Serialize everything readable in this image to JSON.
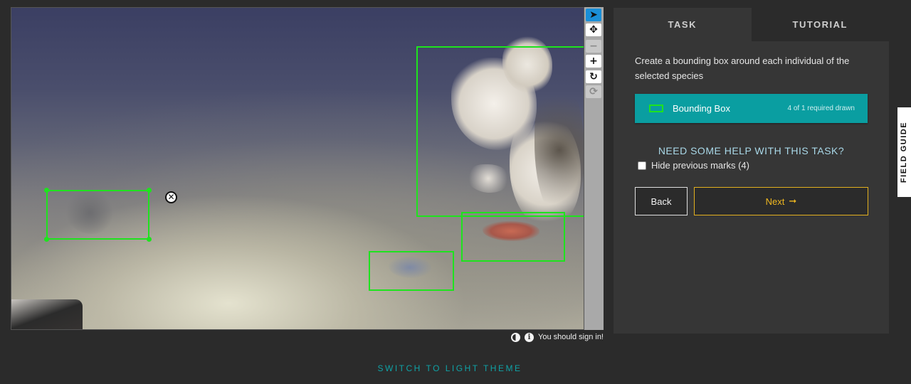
{
  "toolbar": {
    "tools": [
      {
        "name": "annotate",
        "icon": "cursor-arrow-icon",
        "glyph": "➤",
        "state": "active"
      },
      {
        "name": "move",
        "icon": "move-arrows-icon",
        "glyph": "✥",
        "state": "normal"
      },
      {
        "name": "zoom-out",
        "icon": "minus-icon",
        "glyph": "−",
        "state": "disabled"
      },
      {
        "name": "zoom-in",
        "icon": "plus-icon",
        "glyph": "+",
        "state": "normal"
      },
      {
        "name": "rotate",
        "icon": "rotate-icon",
        "glyph": "↻",
        "state": "normal"
      },
      {
        "name": "reset",
        "icon": "reset-icon",
        "glyph": "⟳",
        "state": "disabled"
      }
    ]
  },
  "subject": {
    "delete_glyph": "✕",
    "marks_count": 4
  },
  "meta": {
    "contrast_icon": "contrast-icon",
    "info_icon": "info-icon",
    "info_glyph": "i",
    "sign_in_text": "You should sign in!"
  },
  "task": {
    "tabs": [
      {
        "label": "TASK",
        "active": true
      },
      {
        "label": "TUTORIAL",
        "active": false
      }
    ],
    "instruction": "Create a bounding box around each individual of the selected species",
    "tool_option": {
      "label": "Bounding Box",
      "count_text": "4 of 1 required drawn",
      "color": "#1ee31e"
    },
    "help_heading": "NEED SOME HELP WITH THIS TASK?",
    "hide_marks_label": "Hide previous marks (4)",
    "back_label": "Back",
    "next_label": "Next",
    "next_arrow": "➞"
  },
  "field_guide_label": "FIELD GUIDE",
  "theme_switch_label": "SWITCH TO LIGHT THEME",
  "colors": {
    "background": "#2b2b2b",
    "panel": "#363636",
    "teal": "#0a9ea1",
    "mark_green": "#1ee31e",
    "next_gold": "#f0b820",
    "active_tool": "#1a8fd8"
  }
}
